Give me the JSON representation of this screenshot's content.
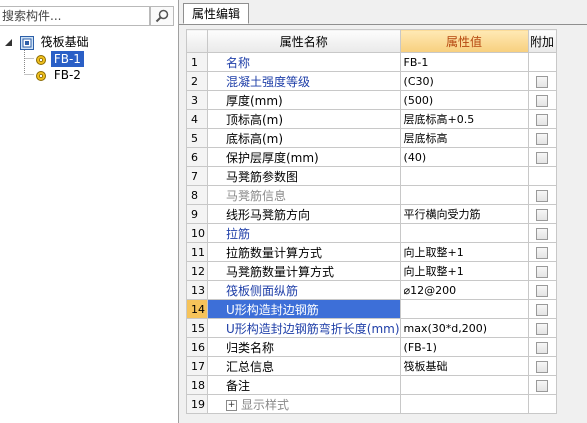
{
  "search": {
    "placeholder": "搜索构件..."
  },
  "tree": {
    "root": {
      "label": "筏板基础"
    },
    "children": [
      {
        "label": "FB-1",
        "selected": true
      },
      {
        "label": "FB-2",
        "selected": false
      }
    ]
  },
  "tab": {
    "label": "属性编辑"
  },
  "grid": {
    "headers": {
      "name": "属性名称",
      "value": "属性值",
      "attach": "附加"
    },
    "rows": [
      {
        "num": "1",
        "name": "名称",
        "value": "FB-1",
        "style": "blue",
        "check": false
      },
      {
        "num": "2",
        "name": "混凝土强度等级",
        "value": "(C30)",
        "style": "blue",
        "check": true
      },
      {
        "num": "3",
        "name": "厚度(mm)",
        "value": "(500)",
        "style": "normal",
        "check": true
      },
      {
        "num": "4",
        "name": "顶标高(m)",
        "value": "层底标高+0.5",
        "style": "normal",
        "check": true
      },
      {
        "num": "5",
        "name": "底标高(m)",
        "value": "层底标高",
        "style": "normal",
        "check": true
      },
      {
        "num": "6",
        "name": "保护层厚度(mm)",
        "value": "(40)",
        "style": "normal",
        "check": true
      },
      {
        "num": "7",
        "name": "马凳筋参数图",
        "value": "",
        "style": "normal",
        "check": false
      },
      {
        "num": "8",
        "name": "马凳筋信息",
        "value": "",
        "style": "gray",
        "check": true
      },
      {
        "num": "9",
        "name": "线形马凳筋方向",
        "value": "平行横向受力筋",
        "style": "normal",
        "check": true
      },
      {
        "num": "10",
        "name": "拉筋",
        "value": "",
        "style": "blue",
        "check": true
      },
      {
        "num": "11",
        "name": "拉筋数量计算方式",
        "value": "向上取整+1",
        "style": "normal",
        "check": true
      },
      {
        "num": "12",
        "name": "马凳筋数量计算方式",
        "value": "向上取整+1",
        "style": "normal",
        "check": true
      },
      {
        "num": "13",
        "name": "筏板侧面纵筋",
        "value": "⌀12@200",
        "style": "blue",
        "check": true
      },
      {
        "num": "14",
        "name": "U形构造封边钢筋",
        "value": "",
        "style": "sel",
        "check": true
      },
      {
        "num": "15",
        "name": "U形构造封边钢筋弯折长度(mm)",
        "value": "max(30*d,200)",
        "style": "blue",
        "check": true
      },
      {
        "num": "16",
        "name": "归类名称",
        "value": "(FB-1)",
        "style": "normal",
        "check": true
      },
      {
        "num": "17",
        "name": "汇总信息",
        "value": "筏板基础",
        "style": "normal",
        "check": true
      },
      {
        "num": "18",
        "name": "备注",
        "value": "",
        "style": "normal",
        "check": true
      },
      {
        "num": "19",
        "name": "显示样式",
        "value": "",
        "style": "gray-expand",
        "check": false
      }
    ]
  }
}
